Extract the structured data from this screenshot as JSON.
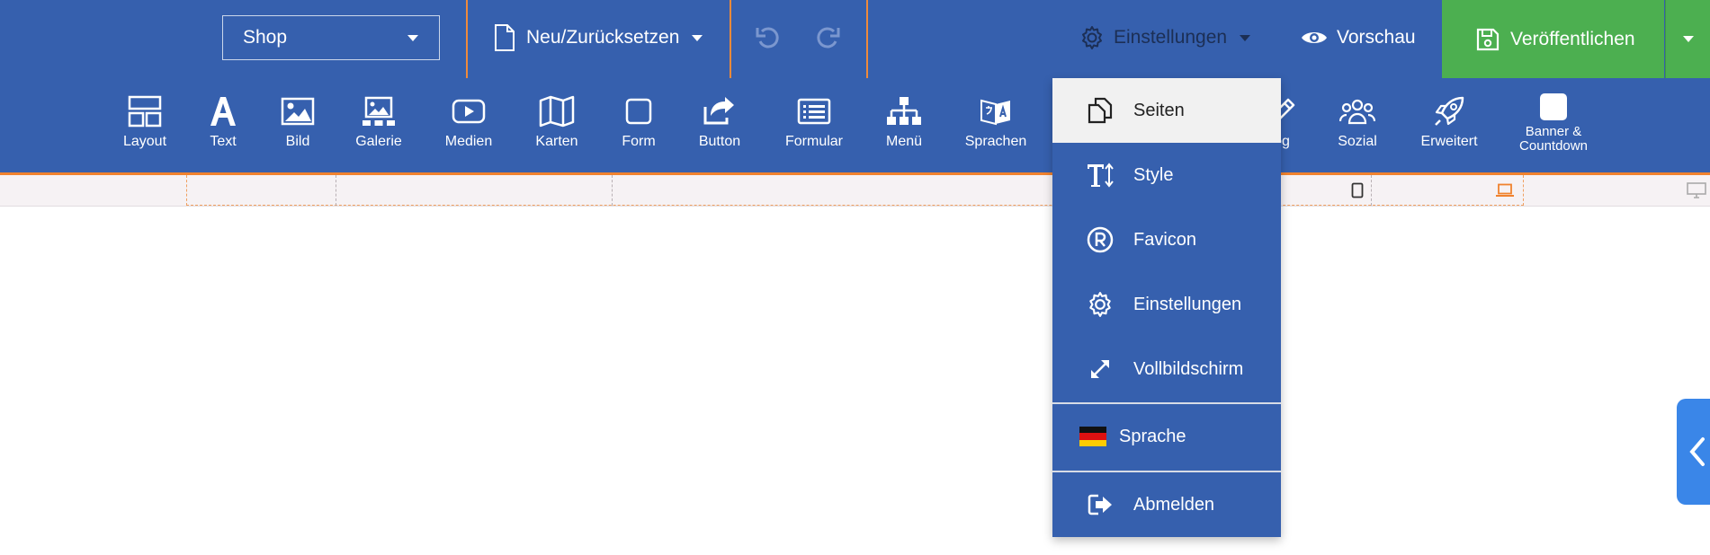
{
  "topbar": {
    "shop_select": "Shop",
    "new_reset": "Neu/Zurücksetzen",
    "settings": "Einstellungen",
    "preview": "Vorschau",
    "publish": "Veröffentlichen"
  },
  "tools": [
    {
      "label": "Layout",
      "icon": "layout-icon"
    },
    {
      "label": "Text",
      "icon": "text-icon"
    },
    {
      "label": "Bild",
      "icon": "image-icon"
    },
    {
      "label": "Galerie",
      "icon": "gallery-icon"
    },
    {
      "label": "Medien",
      "icon": "media-icon"
    },
    {
      "label": "Karten",
      "icon": "map-icon"
    },
    {
      "label": "Form",
      "icon": "form-shape-icon"
    },
    {
      "label": "Button",
      "icon": "share-button-icon"
    },
    {
      "label": "Formular",
      "icon": "form-icon"
    },
    {
      "label": "Menü",
      "icon": "sitemap-icon"
    },
    {
      "label": "Sprachen",
      "icon": "language-icon"
    },
    {
      "label": "og",
      "icon": "pen-icon"
    },
    {
      "label": "Sozial",
      "icon": "users-icon"
    },
    {
      "label": "Erweitert",
      "icon": "rocket-icon"
    },
    {
      "label": "Banner & Countdown",
      "icon": "banner-icon"
    }
  ],
  "settings_menu": {
    "items": [
      {
        "label": "Seiten",
        "icon": "pages-icon"
      },
      {
        "label": "Style",
        "icon": "text-size-icon"
      },
      {
        "label": "Favicon",
        "icon": "registered-icon"
      },
      {
        "label": "Einstellungen",
        "icon": "gear-icon"
      },
      {
        "label": "Vollbildschirm",
        "icon": "expand-icon"
      },
      {
        "label": "Sprache",
        "icon": "german-flag-icon"
      },
      {
        "label": "Abmelden",
        "icon": "logout-icon"
      }
    ]
  },
  "colors": {
    "toolbar": "#3660ae",
    "publish": "#4caf50",
    "accent_orange": "#f0822e",
    "side_tab": "#3a86e8"
  }
}
